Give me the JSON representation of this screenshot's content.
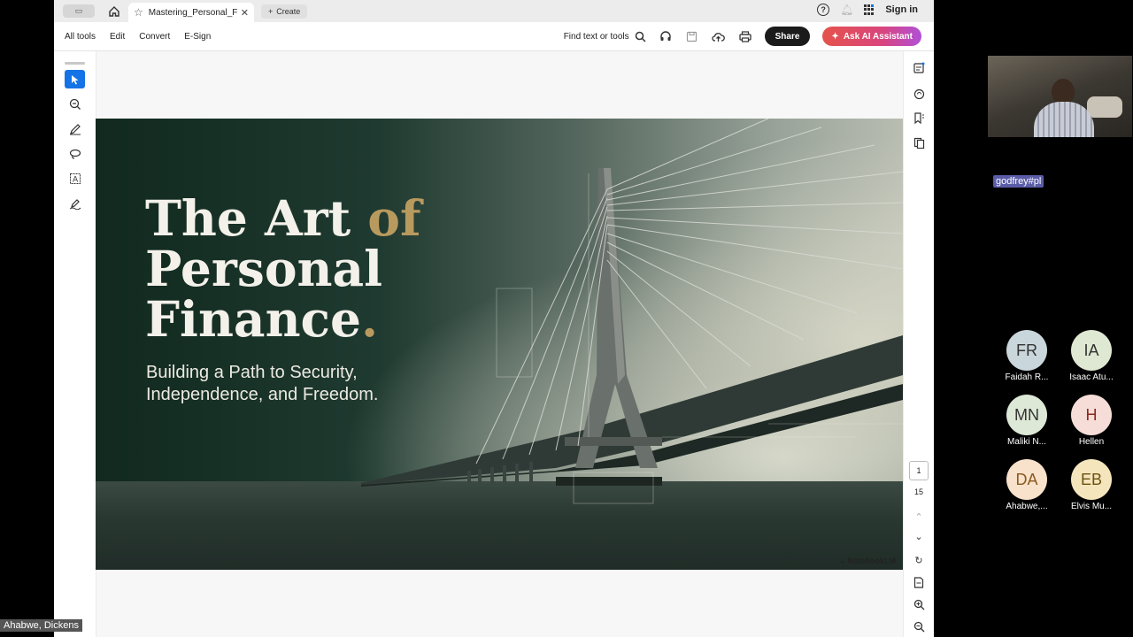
{
  "tabbar": {
    "tab_title": "Mastering_Personal_Fi...",
    "create_label": "Create",
    "signin_label": "Sign in"
  },
  "toolbar": {
    "menu": [
      "All tools",
      "Edit",
      "Convert",
      "E-Sign"
    ],
    "find_label": "Find text or tools",
    "share_label": "Share",
    "ai_label": "Ask AI Assistant"
  },
  "slide": {
    "title_line1a": "The Art ",
    "title_line1b": "of",
    "title_line2": "Personal",
    "title_line3a": "Finance",
    "title_line3b": ".",
    "subtitle_line1": "Building a Path to Security,",
    "subtitle_line2": "Independence, and Freedom.",
    "brand": "NotebookLM"
  },
  "pager": {
    "current": "1",
    "total": "15"
  },
  "call": {
    "presenter_tag": "godfrey#pl",
    "speaker_name": "Ahabwe, Dickens",
    "participants": [
      {
        "initials": "FR",
        "name": "Faidah R...",
        "bg": "#c9d6dc"
      },
      {
        "initials": "IA",
        "name": "Isaac Atu...",
        "bg": "#dfe8d2"
      },
      {
        "initials": "MN",
        "name": "Maliki N...",
        "bg": "#dde8d6"
      },
      {
        "initials": "H",
        "name": "Hellen",
        "bg": "#f6ddd8"
      },
      {
        "initials": "DA",
        "name": "Ahabwe,...",
        "bg": "#f8e2cc"
      },
      {
        "initials": "EB",
        "name": "Elvis Mu...",
        "bg": "#f5e5bd"
      }
    ]
  }
}
